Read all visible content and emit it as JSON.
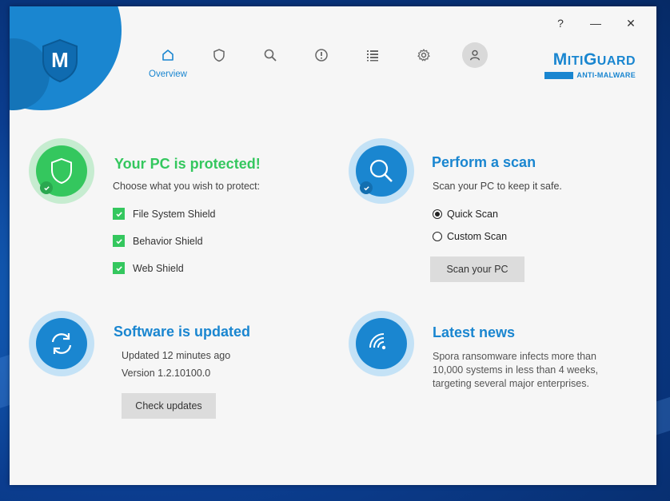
{
  "window": {
    "controls": {
      "help": "?",
      "minimize": "—",
      "close": "✕"
    },
    "accent": "#1a86d0",
    "success": "#34c75e"
  },
  "brand": {
    "name_first_cap": "M",
    "name_first_rest": "ITI",
    "name_second_cap": "G",
    "name_second_rest": "UARD",
    "subtitle": "ANTI-MALWARE",
    "logo_letter": "M"
  },
  "nav": {
    "items": [
      {
        "icon": "home-icon",
        "label": "Overview",
        "active": true
      },
      {
        "icon": "shield-icon",
        "label": ""
      },
      {
        "icon": "search-icon",
        "label": ""
      },
      {
        "icon": "alert-icon",
        "label": ""
      },
      {
        "icon": "list-icon",
        "label": ""
      },
      {
        "icon": "gear-icon",
        "label": ""
      }
    ],
    "avatar_icon": "user-icon"
  },
  "protection": {
    "title": "Your PC is protected!",
    "subtitle": "Choose what you wish to protect:",
    "shields": [
      {
        "label": "File System Shield",
        "checked": true
      },
      {
        "label": "Behavior Shield",
        "checked": true
      },
      {
        "label": "Web Shield",
        "checked": true
      }
    ]
  },
  "scan": {
    "title": "Perform a scan",
    "subtitle": "Scan your PC to keep it safe.",
    "options": [
      {
        "label": "Quick Scan",
        "selected": true
      },
      {
        "label": "Custom Scan",
        "selected": false
      }
    ],
    "button": "Scan your PC"
  },
  "update": {
    "title": "Software is updated",
    "updated": "Updated 12 minutes ago",
    "version": "Version 1.2.10100.0",
    "button": "Check updates"
  },
  "news": {
    "title": "Latest news",
    "body": "Spora ransomware infects more than 10,000 systems in less than 4 weeks, targeting several major enterprises."
  }
}
